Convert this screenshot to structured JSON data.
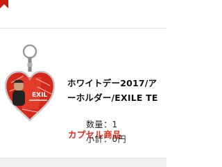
{
  "item": {
    "title_line1": "ホワイトデー2017/ア",
    "title_line2": "ーホルダー/EXILE TE",
    "category": "カプセル商品",
    "quantity_label": "数量：",
    "quantity_value": "1",
    "subtotal_label": "小計：",
    "subtotal_value": "0円",
    "thumbnail": "heart-keychain-photo"
  },
  "colors": {
    "category": "#e62b1a",
    "text": "#111111",
    "heart": "#d42a1c"
  }
}
